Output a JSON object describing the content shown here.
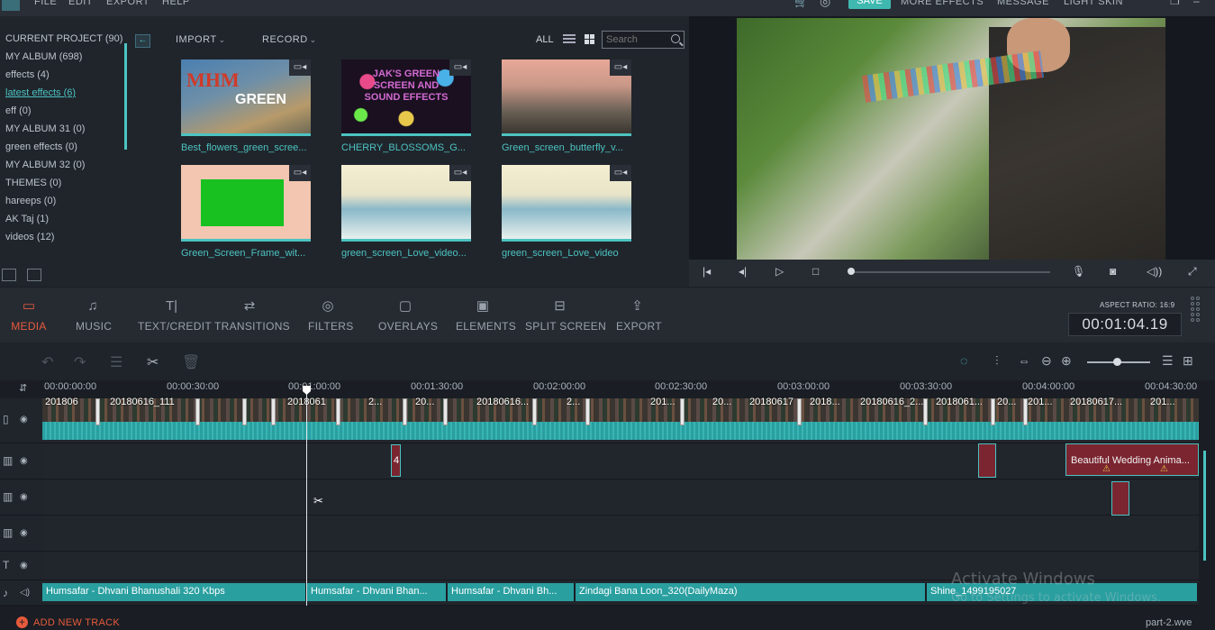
{
  "menubar": {
    "items": [
      "FILE",
      "EDIT",
      "EXPORT",
      "HELP"
    ],
    "save": "SAVE",
    "more_effects": "MORE EFFECTS",
    "message": "MESSAGE",
    "light_skin": "LIGHT SKIN"
  },
  "library": {
    "albums": [
      {
        "label": "CURRENT PROJECT (90)"
      },
      {
        "label": "MY ALBUM (698)"
      },
      {
        "label": "effects (4)"
      },
      {
        "label": "latest effects (6)",
        "active": true
      },
      {
        "label": "eff (0)"
      },
      {
        "label": "MY ALBUM 31 (0)"
      },
      {
        "label": "green effects (0)"
      },
      {
        "label": "MY ALBUM 32 (0)"
      },
      {
        "label": "THEMES (0)"
      },
      {
        "label": "hareeps (0)"
      },
      {
        "label": "AK Taj (1)"
      },
      {
        "label": "videos (12)"
      }
    ],
    "import_label": "IMPORT",
    "record_label": "RECORD",
    "all_label": "ALL",
    "search_placeholder": "Search",
    "thumbs": [
      {
        "name": "Best_flowers_green_scree...",
        "text": "MHM  GREEN"
      },
      {
        "name": "CHERRY_BLOSSOMS_G...",
        "text": "JAK'S GREEN SCREEN AND SOUND EFFECTS"
      },
      {
        "name": "Green_screen_butterfly_v...",
        "text": ""
      },
      {
        "name": "Green_Screen_Frame_wit...",
        "text": ""
      },
      {
        "name": "green_screen_Love_video...",
        "text": ""
      },
      {
        "name": "green_screen_Love_video",
        "text": ""
      }
    ]
  },
  "toolbar": {
    "tools": [
      "MEDIA",
      "MUSIC",
      "TEXT/CREDIT",
      "TRANSITIONS",
      "FILTERS",
      "OVERLAYS",
      "ELEMENTS",
      "SPLIT SCREEN",
      "EXPORT"
    ],
    "aspect_ratio": "ASPECT RATIO: 16:9",
    "timecode": "00:01:04.19"
  },
  "timeline": {
    "ruler": [
      "00:00:00:00",
      "00:00:30:00",
      "00:01:00:00",
      "00:01:30:00",
      "00:02:00:00",
      "00:02:30:00",
      "00:03:00:00",
      "00:03:30:00",
      "00:04:00:00",
      "00:04:30:00"
    ],
    "video_labels": [
      "201806",
      "20180616_111",
      "2018061",
      "2...",
      "20...",
      "20180616...",
      "2...",
      "201...",
      "20...",
      "20180617",
      "2018...",
      "20180616_2...",
      "2018061...",
      "20...",
      "201...",
      "20180617...",
      "201..."
    ],
    "overlay_number": "4",
    "wedding_clip": "Beautiful Wedding Anima...",
    "music_clips": [
      "Humsafar - Dhvani Bhanushali 320 Kbps",
      "Humsafar - Dhvani Bhan...",
      "Humsafar - Dhvani Bh...",
      "Zindagi Bana Loon_320(DailyMaza)",
      "Shine_1499195027"
    ],
    "add_track": "ADD NEW TRACK",
    "file_name": "part-2.wve"
  },
  "watermark": {
    "line1": "Activate Windows",
    "line2": "Go to Settings to activate Windows."
  },
  "colors": {
    "accent": "#4cc3c1",
    "active_tab": "#e85a3c"
  }
}
